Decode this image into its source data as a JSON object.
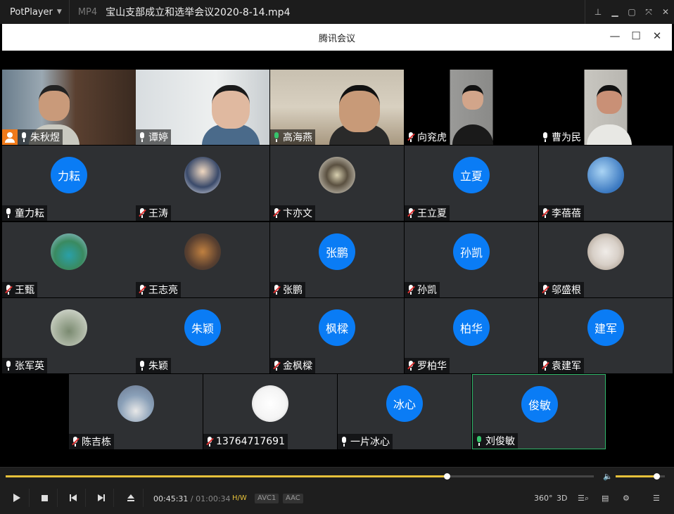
{
  "player": {
    "brand": "PotPlayer",
    "format": "MP4",
    "filename": "宝山支部成立和选举会议2020-8-14.mp4",
    "window_buttons": [
      "pin-icon",
      "minimize-icon",
      "restore-icon",
      "fullscreen-icon",
      "close-icon"
    ]
  },
  "meeting": {
    "title": "腾讯会议",
    "window_buttons": [
      "minimize-icon",
      "maximize-icon",
      "close-icon"
    ]
  },
  "participants": [
    {
      "name": "朱秋煜",
      "mic": "on",
      "host": true,
      "video": true
    },
    {
      "name": "谭婷",
      "mic": "on",
      "video": true
    },
    {
      "name": "高海燕",
      "mic": "speaking",
      "video": true
    },
    {
      "name": "向兖虎",
      "mic": "muted",
      "video": true
    },
    {
      "name": "曹为民",
      "mic": "on",
      "video": true
    },
    {
      "name": "童力耘",
      "mic": "on",
      "avatar_text": "力耘"
    },
    {
      "name": "王涛",
      "mic": "muted",
      "avatar_photo": true
    },
    {
      "name": "卞亦文",
      "mic": "muted",
      "avatar_photo": true
    },
    {
      "name": "王立夏",
      "mic": "muted",
      "avatar_text": "立夏"
    },
    {
      "name": "李蓓蓓",
      "mic": "muted",
      "avatar_photo": true
    },
    {
      "name": "王甄",
      "mic": "muted",
      "avatar_photo": true
    },
    {
      "name": "王志亮",
      "mic": "muted",
      "avatar_photo": true
    },
    {
      "name": "张鹏",
      "mic": "muted",
      "avatar_text": "张鹏"
    },
    {
      "name": "孙凯",
      "mic": "muted",
      "avatar_text": "孙凯"
    },
    {
      "name": "邬盛根",
      "mic": "muted",
      "avatar_photo": true
    },
    {
      "name": "张军英",
      "mic": "on",
      "avatar_photo": true
    },
    {
      "name": "朱颖",
      "mic": "on",
      "avatar_text": "朱颖"
    },
    {
      "name": "金枫樑",
      "mic": "muted",
      "avatar_text": "枫樑"
    },
    {
      "name": "罗柏华",
      "mic": "muted",
      "avatar_text": "柏华"
    },
    {
      "name": "袁建军",
      "mic": "muted",
      "avatar_text": "建军"
    },
    {
      "name": "陈吉栋",
      "mic": "muted",
      "avatar_photo": true
    },
    {
      "name": "13764717691",
      "mic": "muted",
      "avatar_photo": true
    },
    {
      "name": "一片冰心",
      "mic": "on",
      "avatar_text": "冰心"
    },
    {
      "name": "刘俊敏",
      "mic": "speaking",
      "avatar_text": "俊敏",
      "active": true
    }
  ],
  "controls": {
    "current_time": "00:45:31",
    "separator": "/",
    "total_time": "01:00:34",
    "hw_badge": "H/W",
    "video_codec": "AVC1",
    "audio_codec": "AAC",
    "progress_fraction": 0.75,
    "volume_fraction": 0.83,
    "vr_label": "360°",
    "three_d_label": "3D"
  },
  "colors": {
    "avatar_blue": "#0a7cf5",
    "speaking_green": "#36c46c",
    "muted_red": "#e03030",
    "progress_yellow": "#e6c13a",
    "host_orange": "#f07a1a"
  }
}
